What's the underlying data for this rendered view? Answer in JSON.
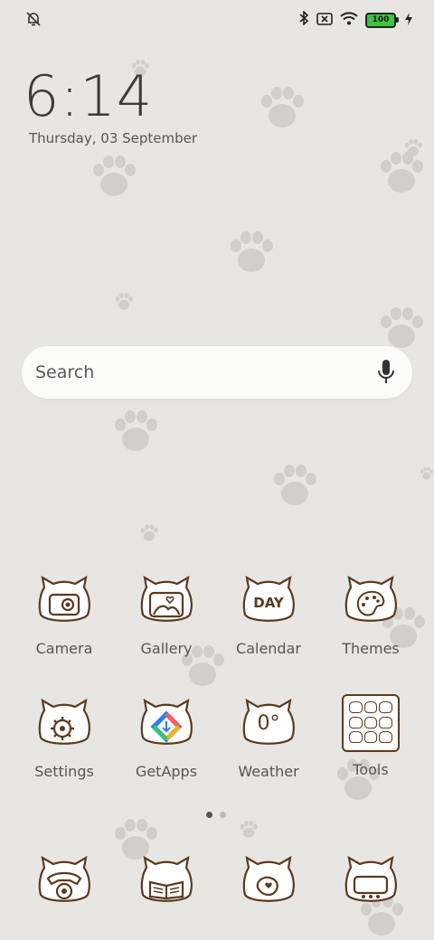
{
  "statusbar": {
    "battery": "100"
  },
  "clock": {
    "time": "6:14",
    "date": "Thursday, 03 September"
  },
  "search": {
    "placeholder": "Search"
  },
  "apps_row1": [
    {
      "label": "Camera"
    },
    {
      "label": "Gallery"
    },
    {
      "label": "Calendar"
    },
    {
      "label": "Themes"
    }
  ],
  "apps_row2": [
    {
      "label": "Settings"
    },
    {
      "label": "GetApps"
    },
    {
      "label": "Weather"
    },
    {
      "label": "Tools"
    }
  ],
  "calendar_badge": "DAY",
  "weather_badge": "0°",
  "colors": {
    "background": "#e8e6e3",
    "icon_outline": "#5b3a1e",
    "paw": "#d2cfcb"
  }
}
